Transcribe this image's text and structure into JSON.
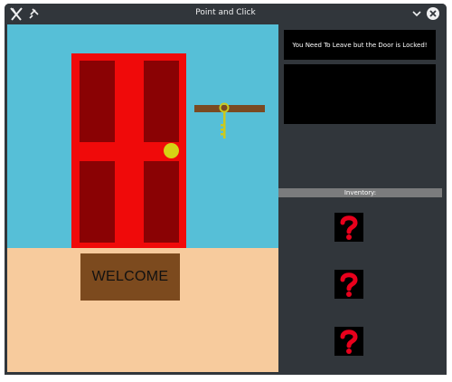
{
  "window": {
    "title": "Point and Click"
  },
  "scene": {
    "mat_text": "WELCOME"
  },
  "panel": {
    "message": "You Need To Leave but the Door is Locked!",
    "secondary_message": "",
    "inventory_label": "Inventory:",
    "inventory": [
      {
        "item": "unknown",
        "icon": "question-mark-icon"
      },
      {
        "item": "unknown",
        "icon": "question-mark-icon"
      },
      {
        "item": "unknown",
        "icon": "question-mark-icon"
      }
    ]
  },
  "colors": {
    "window_bg": "#31363b",
    "wall": "#56bfd7",
    "floor": "#f7cb9d",
    "door": "#f00a0a",
    "door_panel": "#8a0204",
    "knob": "#d6d214",
    "mat": "#7c4a1e",
    "shelf": "#7a4a22",
    "key": "#cbc91e",
    "question_mark": "#e8001c"
  }
}
